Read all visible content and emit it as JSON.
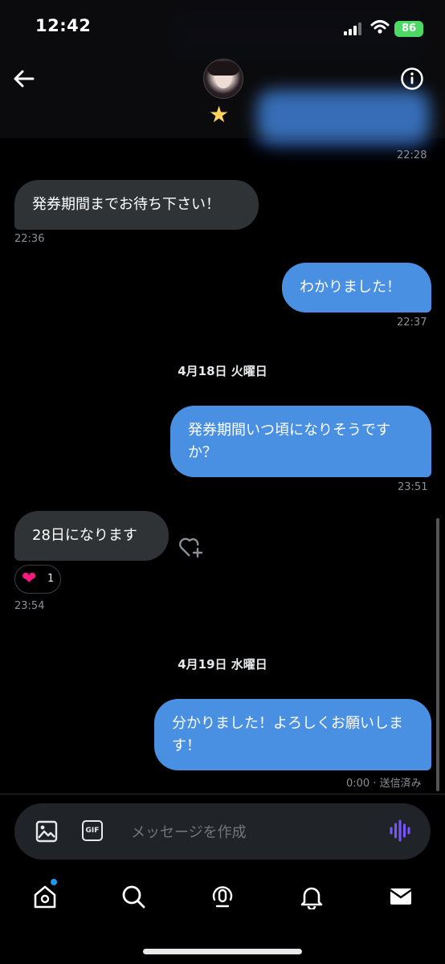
{
  "status_bar": {
    "time": "12:42",
    "battery": "86"
  },
  "header": {
    "badge_icon": "star-icon",
    "back_icon": "arrow-left-icon",
    "info_icon": "info-icon"
  },
  "messages": [
    {
      "direction": "received",
      "text": "発券期間までお待ち下さい！",
      "time": "22:36"
    },
    {
      "direction": "sent",
      "text": "わかりました！",
      "time": "22:37"
    },
    {
      "direction": "sent",
      "text": "発券期間いつ頃になりそうですか？",
      "time": "23:51"
    },
    {
      "direction": "received",
      "text": "28日になります",
      "time": "23:54",
      "reaction": {
        "emoji": "❤",
        "count": "1"
      }
    },
    {
      "direction": "sent",
      "text": "分かりました！よろしくお願いします！",
      "time": "0:00 · 送信済み"
    }
  ],
  "earlier_time": "22:28",
  "date_separators": [
    "4月18日 火曜日",
    "4月19日 水曜日"
  ],
  "composer": {
    "placeholder": "メッセージを作成",
    "gif_label": "GIF"
  },
  "nav": [
    "home-icon",
    "search-icon",
    "spaces-icon",
    "bell-icon",
    "mail-icon"
  ],
  "colors": {
    "sent_bubble": "#4a90e2",
    "received_bubble": "#2f3336",
    "accent": "#1d9bf0",
    "voice": "#7856ff"
  }
}
